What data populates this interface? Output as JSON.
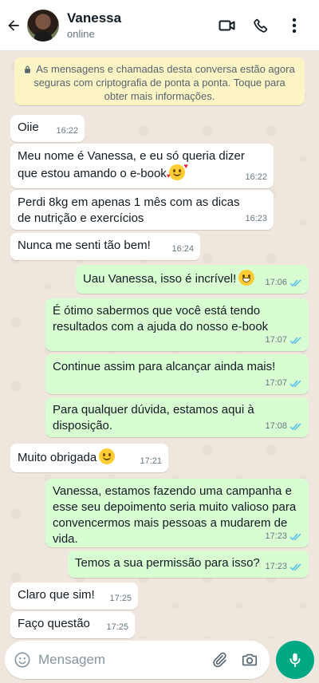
{
  "header": {
    "contact_name": "Vanessa",
    "status": "online"
  },
  "notice": {
    "text": "As mensagens e chamadas desta conversa estão agora seguras com criptografia de ponta a ponta. Toque para obter mais informações."
  },
  "messages": [
    {
      "direction": "in",
      "text": "Oiie",
      "time": "16:22"
    },
    {
      "direction": "in",
      "text": "Meu nome é Vanessa, e eu só queria dizer que estou amando o e-book",
      "emoji": "smiling-face-with-hearts",
      "time": "16:22"
    },
    {
      "direction": "in",
      "text": "Perdi 8kg em apenas 1 mês com as dicas de nutrição e exercícios",
      "time": "16:23"
    },
    {
      "direction": "in",
      "text": "Nunca me senti tão bem!",
      "time": "16:24"
    },
    {
      "direction": "out",
      "text": "Uau Vanessa, isso é incrível!",
      "emoji": "grinning-face",
      "time": "17:06",
      "read": true
    },
    {
      "direction": "out",
      "text": "É ótimo sabermos que você está tendo resultados com a ajuda do nosso e-book",
      "time": "17:07",
      "read": true
    },
    {
      "direction": "out",
      "text": "Continue assim para alcançar ainda mais!",
      "time": "17:07",
      "read": true
    },
    {
      "direction": "out",
      "text": "Para qualquer dúvida, estamos aqui à disposição.",
      "time": "17:08",
      "read": true
    },
    {
      "direction": "in",
      "text": "Muito obrigada",
      "emoji": "smiling-face",
      "time": "17:21"
    },
    {
      "direction": "out",
      "text": "Vanessa, estamos fazendo uma campanha e esse seu depoimento seria muito valioso para convencermos mais pessoas a mudarem de vida.",
      "time": "17:23",
      "read": true
    },
    {
      "direction": "out",
      "text": "Temos a sua permissão para isso?",
      "time": "17:23",
      "read": true
    },
    {
      "direction": "in",
      "text": "Claro que sim!",
      "time": "17:25"
    },
    {
      "direction": "in",
      "text": "Faço questão",
      "time": "17:25"
    }
  ],
  "composer": {
    "placeholder": "Mensagem"
  },
  "colors": {
    "incoming_bubble": "#ffffff",
    "outgoing_bubble": "#d9fdd3",
    "read_ticks": "#53bdeb",
    "mic_button": "#00a884",
    "chat_background": "#efe7de",
    "notice_background": "#fdf4c5"
  },
  "icons": [
    "back-arrow-icon",
    "video-call-icon",
    "phone-icon",
    "more-vert-icon",
    "lock-icon",
    "emoji-icon",
    "attach-icon",
    "camera-icon",
    "mic-icon",
    "double-check-icon"
  ]
}
